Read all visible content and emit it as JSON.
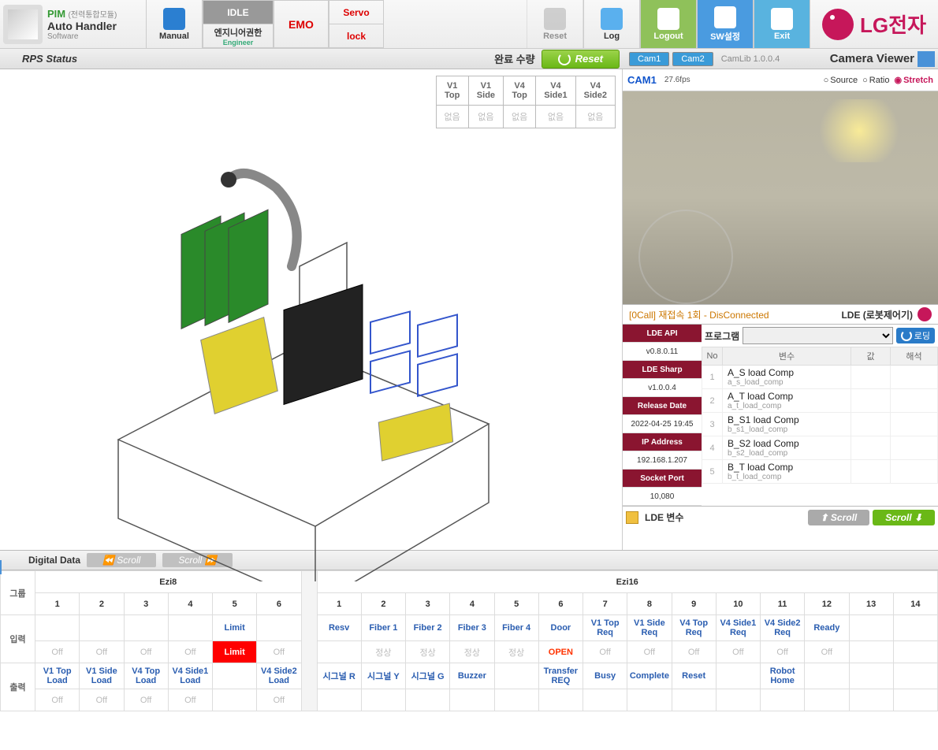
{
  "app": {
    "pim_label": "PIM",
    "pim_sub": "(전력통합모듈)",
    "auto_handler": "Auto Handler",
    "software": "Software"
  },
  "toolbar": {
    "manual": "Manual",
    "idle": "IDLE",
    "engineer": "엔지니어권한",
    "engineer_en": "Engineer",
    "emo": "EMO",
    "servo": "Servo",
    "lock": "lock",
    "reset": "Reset",
    "log": "Log",
    "logout": "Logout",
    "sw_config": "SW설정",
    "exit": "Exit"
  },
  "brand": "LG전자",
  "second_bar": {
    "rps_status": "RPS Status",
    "done_qty": "완료 수량",
    "reset": "Reset",
    "cam1": "Cam1",
    "cam2": "Cam2",
    "camlib": "CamLib 1.0.0.4",
    "camera_viewer": "Camera Viewer"
  },
  "v_table": {
    "headers": [
      "V1\nTop",
      "V1\nSide",
      "V4\nTop",
      "V4\nSide1",
      "V4\nSide2"
    ],
    "h0": "V1",
    "h0b": "Top",
    "h1": "V1",
    "h1b": "Side",
    "h2": "V4",
    "h2b": "Top",
    "h3": "V4",
    "h3b": "Side1",
    "h4": "V4",
    "h4b": "Side2",
    "cells": [
      "없음",
      "없음",
      "없음",
      "없음",
      "없음"
    ]
  },
  "cam": {
    "name": "CAM1",
    "fps": "27.6fps",
    "radio_source": "Source",
    "radio_ratio": "Ratio",
    "radio_stretch": "Stretch"
  },
  "status": {
    "disconn": "[0Call] 재접속 1회 - DisConnected",
    "lde_title": "LDE (로봇제어기)"
  },
  "lde_info": {
    "api_label": "LDE API",
    "api_ver": "v0.8.0.11",
    "sharp_label": "LDE Sharp",
    "sharp_ver": "v1.0.0.4",
    "release_label": "Release Date",
    "release_val": "2022-04-25 19:45",
    "ip_label": "IP Address",
    "ip_val": "192.168.1.207",
    "port_label": "Socket Port",
    "port_val": "10,080"
  },
  "program": {
    "label": "프로그램",
    "loading": "로딩",
    "th_no": "No",
    "th_var": "변수",
    "th_val": "값",
    "th_interp": "해석",
    "rows": [
      {
        "no": "1",
        "name": "A_S load Comp",
        "sub": "a_s_load_comp"
      },
      {
        "no": "2",
        "name": "A_T load Comp",
        "sub": "a_t_load_comp"
      },
      {
        "no": "3",
        "name": "B_S1 load Comp",
        "sub": "b_s1_load_comp"
      },
      {
        "no": "4",
        "name": "B_S2 load Comp",
        "sub": "b_s2_load_comp"
      },
      {
        "no": "5",
        "name": "B_T load Comp",
        "sub": "b_t_load_comp"
      }
    ]
  },
  "lde_footer": {
    "lde_var": "LDE 변수",
    "scroll": "Scroll"
  },
  "dd": {
    "title": "Digital Data",
    "scroll": "Scroll",
    "group_label": "그룹",
    "input_label": "입력",
    "output_label": "출력",
    "ezi8": "Ezi8",
    "ezi16": "Ezi16",
    "nums": [
      "1",
      "2",
      "3",
      "4",
      "5",
      "6",
      "7",
      "8",
      "9",
      "10",
      "11",
      "12",
      "13",
      "14"
    ],
    "in_labels": [
      "",
      "",
      "",
      "",
      "Limit",
      "",
      "Resv",
      "Fiber 1",
      "Fiber 2",
      "Fiber 3",
      "Fiber 4",
      "Door",
      "V1 Top Req",
      "V1 Side Req",
      "V4 Top Req",
      "V4 Side1 Req",
      "V4 Side2 Req",
      "Ready"
    ],
    "in_vals": [
      "Off",
      "Off",
      "Off",
      "Off",
      "Limit",
      "Off",
      "",
      "정상",
      "정상",
      "정상",
      "정상",
      "OPEN",
      "Off",
      "Off",
      "Off",
      "Off",
      "Off",
      "Off"
    ],
    "out_labels": [
      "V1 Top Load",
      "V1 Side Load",
      "V4 Top Load",
      "V4 Side1 Load",
      "",
      "V4 Side2 Load",
      "시그널 R",
      "시그널 Y",
      "시그널 G",
      "Buzzer",
      "",
      "Transfer REQ",
      "Busy",
      "Complete",
      "Reset",
      "",
      "Robot Home",
      ""
    ],
    "out_vals": [
      "Off",
      "Off",
      "Off",
      "Off",
      "",
      "Off",
      "",
      "",
      "",
      "",
      "",
      "",
      "",
      "",
      "",
      "",
      "",
      ""
    ]
  }
}
